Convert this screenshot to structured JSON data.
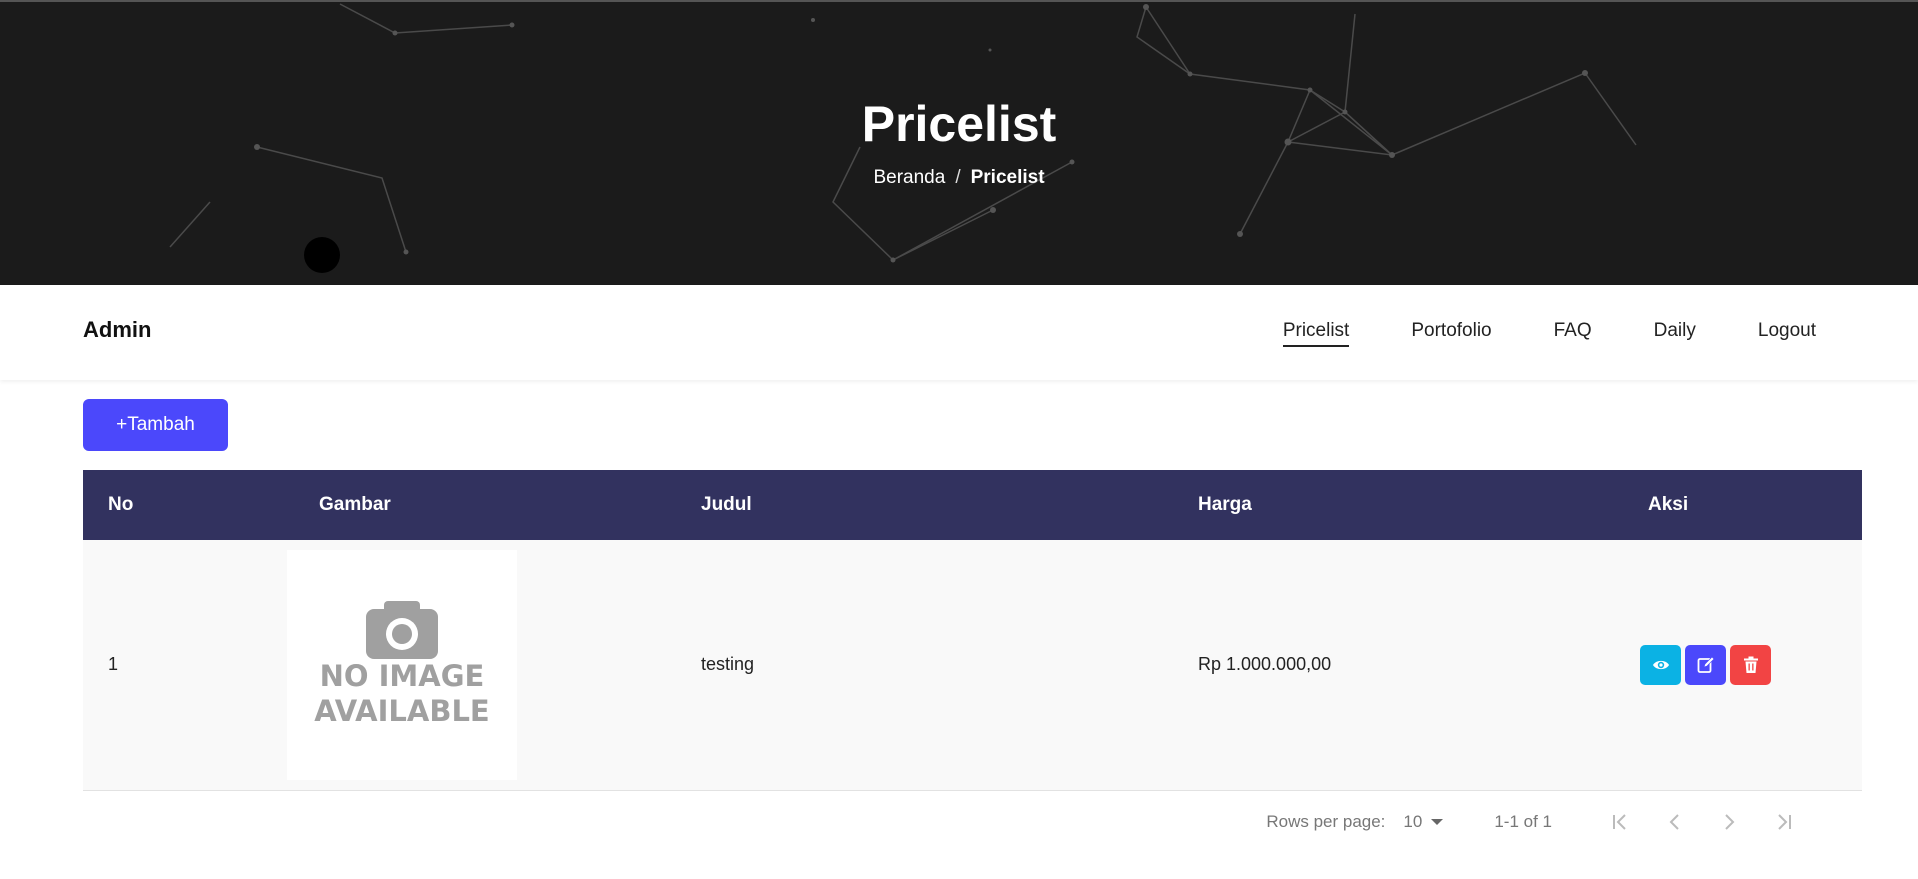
{
  "hero": {
    "title": "Pricelist",
    "breadcrumb": {
      "home": "Beranda",
      "separator": "/",
      "current": "Pricelist"
    }
  },
  "navbar": {
    "brand": "Admin",
    "links": [
      {
        "label": "Pricelist",
        "active": true
      },
      {
        "label": "Portofolio",
        "active": false
      },
      {
        "label": "FAQ",
        "active": false
      },
      {
        "label": "Daily",
        "active": false
      },
      {
        "label": "Logout",
        "active": false
      }
    ]
  },
  "toolbar": {
    "add_label": "+Tambah"
  },
  "table": {
    "headers": [
      "No",
      "Gambar",
      "Judul",
      "Harga",
      "Aksi"
    ],
    "rows": [
      {
        "no": "1",
        "image_placeholder_line1": "NO IMAGE",
        "image_placeholder_line2": "AVAILABLE",
        "title": "testing",
        "price": "Rp 1.000.000,00",
        "actions": [
          "eye-icon",
          "edit-icon",
          "trash-icon"
        ]
      }
    ]
  },
  "pagination": {
    "rows_per_page_label": "Rows per page:",
    "rows_per_page_value": "10",
    "range": "1-1 of 1"
  },
  "colors": {
    "hero_bg": "#1b1b1b",
    "primary": "#4b48fb",
    "table_header": "#32325f",
    "view": "#0bb2e4",
    "delete": "#f24444"
  }
}
